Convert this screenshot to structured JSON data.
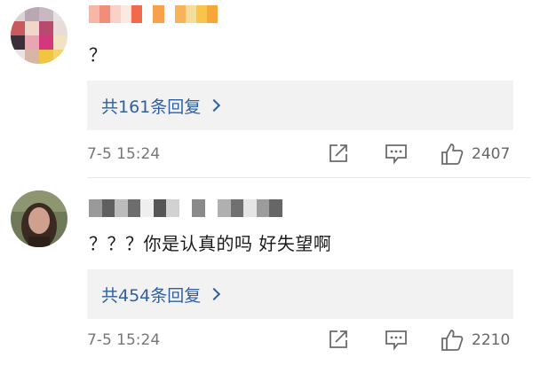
{
  "comments": [
    {
      "username": "",
      "content": "？",
      "replies_label": "共161条回复",
      "time": "7-5 15:24",
      "likes": "2407",
      "icons": {
        "share": "share-icon",
        "comment": "comment-icon",
        "like": "thumbs-up-icon"
      }
    },
    {
      "username": "",
      "content": "？？？你是认真的吗 好失望啊",
      "replies_label": "共454条回复",
      "time": "7-5 15:24",
      "likes": "2210",
      "icons": {
        "share": "share-icon",
        "comment": "comment-icon",
        "like": "thumbs-up-icon"
      }
    }
  ],
  "colors": {
    "reply_link": "#2f5fa0",
    "reply_bg": "#f2f2f2",
    "meta_text": "#777777"
  }
}
